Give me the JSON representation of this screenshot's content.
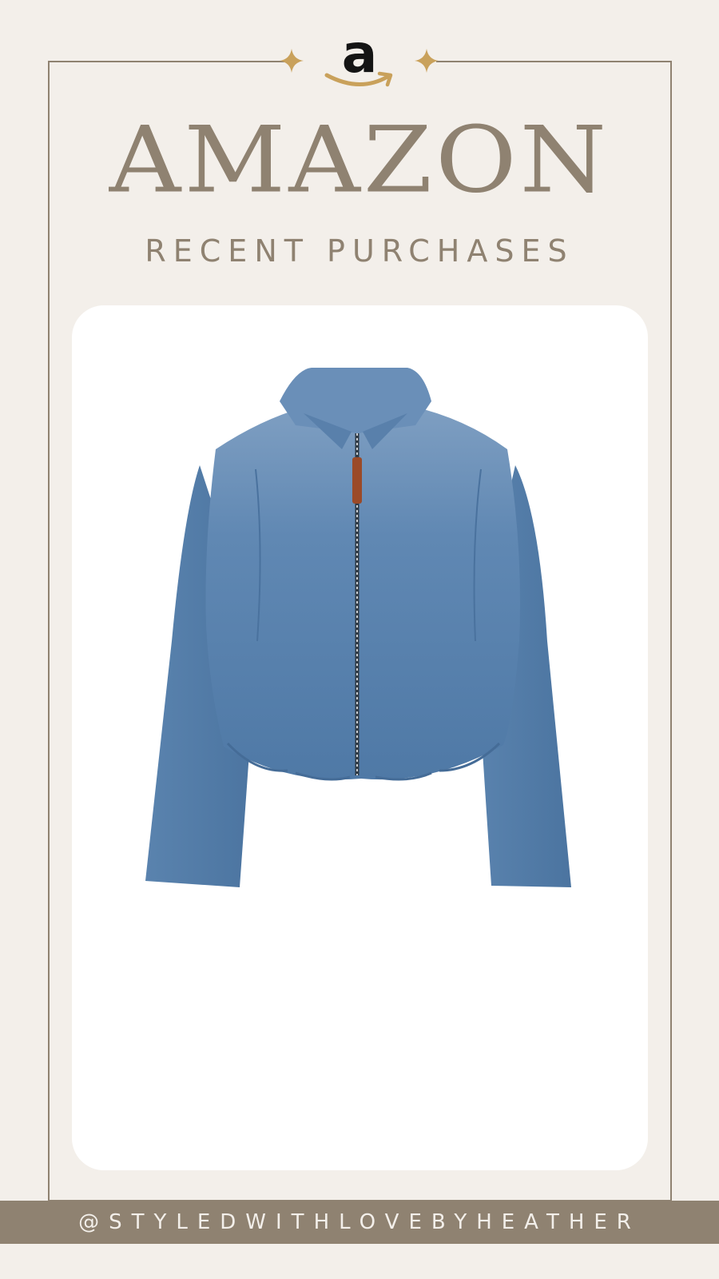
{
  "logo": {
    "letter": "a",
    "name": "amazon-logo"
  },
  "header": {
    "title": "AMAZON",
    "subtitle": "RECENT PURCHASES"
  },
  "product": {
    "image": "denim-zip-jacket",
    "icon": "sparkle-icon"
  },
  "footer": {
    "handle": "@STYLEDWITHLOVEBYHEATHER"
  },
  "colors": {
    "background": "#f3efea",
    "accent": "#8f8271",
    "gold": "#c9a15b",
    "card": "#ffffff",
    "denim": "#5b82ab"
  }
}
